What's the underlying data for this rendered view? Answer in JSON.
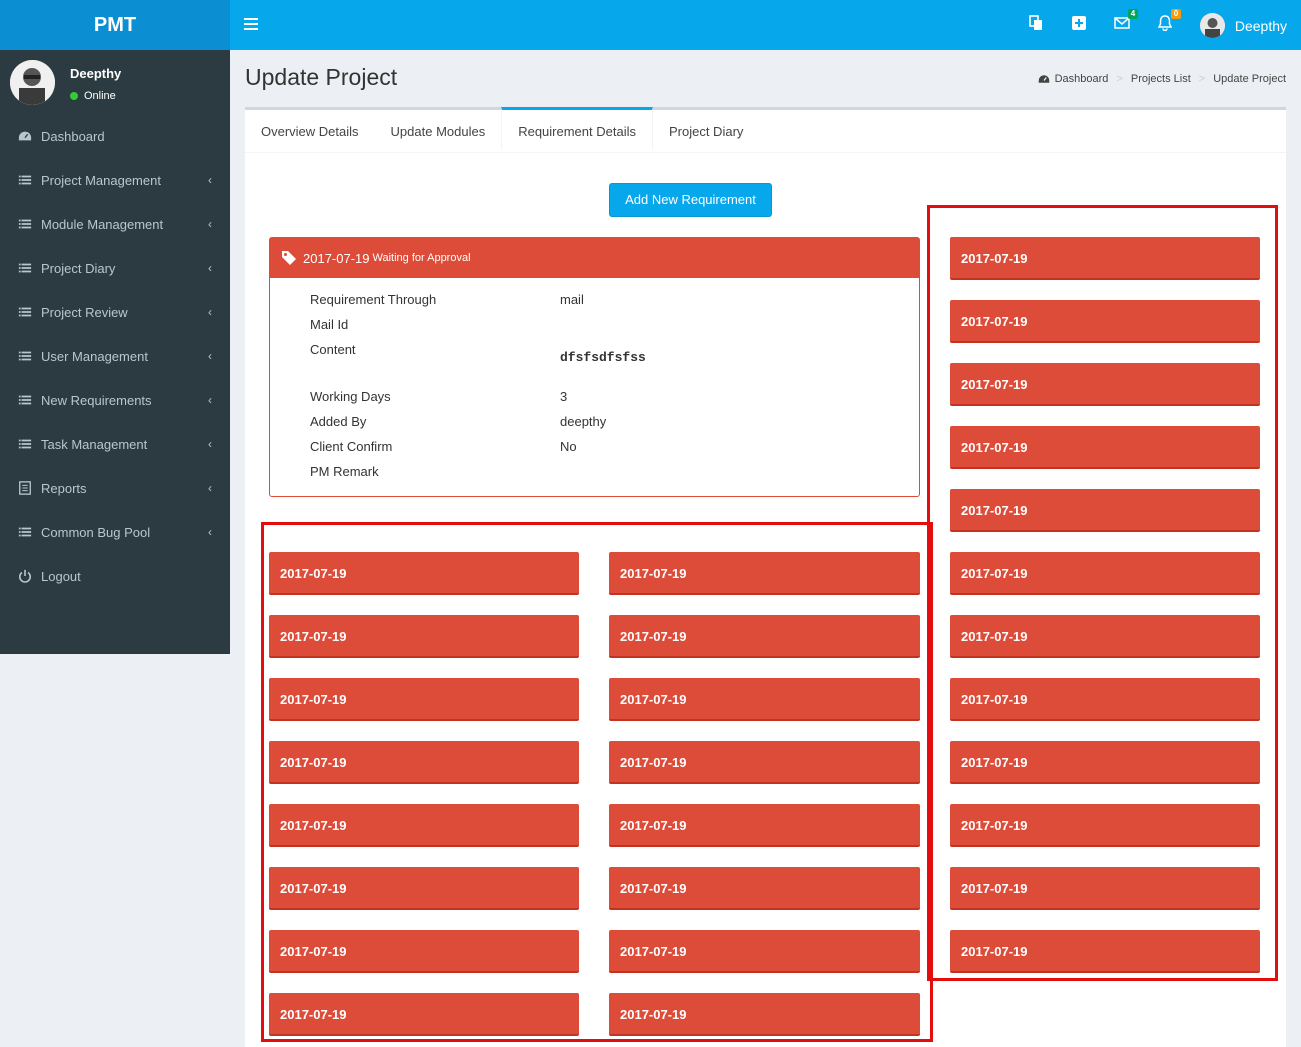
{
  "app": {
    "title": "PMT"
  },
  "topbar": {
    "mail_count": "4",
    "bell_count": "0",
    "user_name": "Deepthy",
    "colors": {
      "brand": "#07a7ec",
      "logo_bg": "#0c8fd2",
      "mail_badge": "#00a65a",
      "bell_badge": "#f39c12"
    }
  },
  "sidebar": {
    "user_name": "Deepthy",
    "status": "Online",
    "items": [
      {
        "label": "Dashboard",
        "icon": "dashboard-icon",
        "has_arrow": false
      },
      {
        "label": "Project Management",
        "icon": "list-icon",
        "has_arrow": true
      },
      {
        "label": "Module Management",
        "icon": "list-icon",
        "has_arrow": true
      },
      {
        "label": "Project Diary",
        "icon": "list-icon",
        "has_arrow": true
      },
      {
        "label": "Project Review",
        "icon": "list-icon",
        "has_arrow": true
      },
      {
        "label": "User Management",
        "icon": "list-icon",
        "has_arrow": true
      },
      {
        "label": "New Requirements",
        "icon": "list-icon",
        "has_arrow": true
      },
      {
        "label": "Task Management",
        "icon": "list-icon",
        "has_arrow": true
      },
      {
        "label": "Reports",
        "icon": "report-icon",
        "has_arrow": true
      },
      {
        "label": "Common Bug Pool",
        "icon": "list-icon",
        "has_arrow": true
      },
      {
        "label": "Logout",
        "icon": "power-icon",
        "has_arrow": false
      }
    ]
  },
  "page": {
    "title": "Update Project",
    "breadcrumb": [
      "Dashboard",
      "Projects List",
      "Update Project"
    ],
    "tabs": [
      "Overview Details",
      "Update Modules",
      "Requirement Details",
      "Project Diary"
    ],
    "active_tab": "Requirement Details",
    "add_button": "Add New Requirement"
  },
  "requirement": {
    "date": "2017-07-19",
    "status": "Waiting for Approval",
    "fields": [
      {
        "label": "Requirement Through",
        "value": "mail"
      },
      {
        "label": "Mail Id",
        "value": ""
      },
      {
        "label": "Content",
        "value": "dfsfsdfsfss"
      },
      {
        "label": "Working Days",
        "value": "3"
      },
      {
        "label": "Added By",
        "value": "deepthy"
      },
      {
        "label": "Client Confirm",
        "value": "No"
      },
      {
        "label": "PM Remark",
        "value": ""
      }
    ],
    "color": "#dd4b39"
  },
  "cards": {
    "left": [
      "2017-07-19",
      "2017-07-19",
      "2017-07-19",
      "2017-07-19",
      "2017-07-19",
      "2017-07-19",
      "2017-07-19",
      "2017-07-19"
    ],
    "mid": [
      "2017-07-19",
      "2017-07-19",
      "2017-07-19",
      "2017-07-19",
      "2017-07-19",
      "2017-07-19",
      "2017-07-19",
      "2017-07-19"
    ],
    "right": [
      "2017-07-19",
      "2017-07-19",
      "2017-07-19",
      "2017-07-19",
      "2017-07-19",
      "2017-07-19",
      "2017-07-19",
      "2017-07-19",
      "2017-07-19",
      "2017-07-19",
      "2017-07-19",
      "2017-07-19"
    ]
  },
  "highlight_color": "#e30d0d"
}
